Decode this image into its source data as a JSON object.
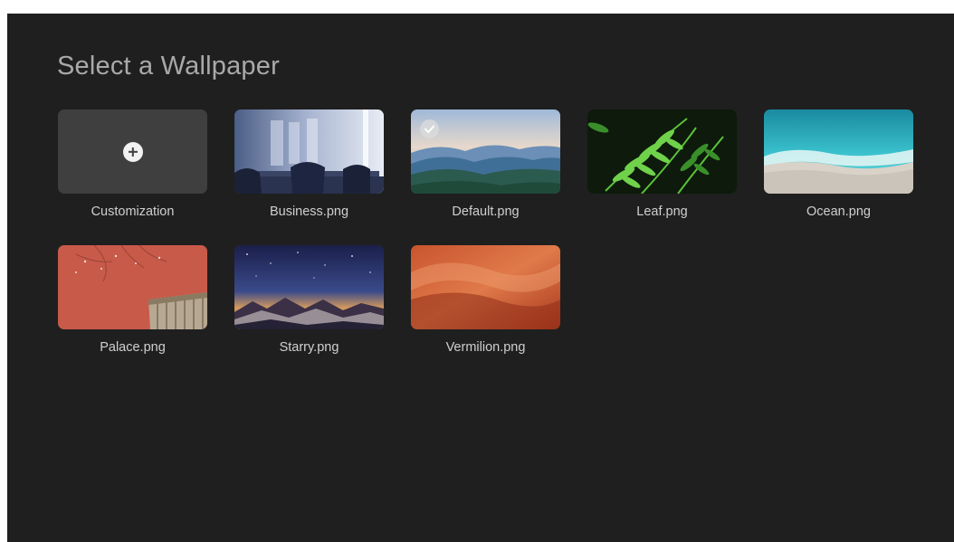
{
  "page": {
    "title": "Select a Wallpaper"
  },
  "wallpapers": [
    {
      "label": "Customization",
      "icon": "plus-icon",
      "selected": false
    },
    {
      "label": "Business.png",
      "selected": false
    },
    {
      "label": "Default.png",
      "selected": true,
      "icon": "check-icon"
    },
    {
      "label": "Leaf.png",
      "selected": false
    },
    {
      "label": "Ocean.png",
      "selected": false
    },
    {
      "label": "Palace.png",
      "selected": false
    },
    {
      "label": "Starry.png",
      "selected": false
    },
    {
      "label": "Vermilion.png",
      "selected": false
    }
  ],
  "colors": {
    "background": "#1f1f1f",
    "title": "#a9a9a9",
    "label": "#cfcfcf",
    "custom_tile": "#3f3f3f"
  }
}
